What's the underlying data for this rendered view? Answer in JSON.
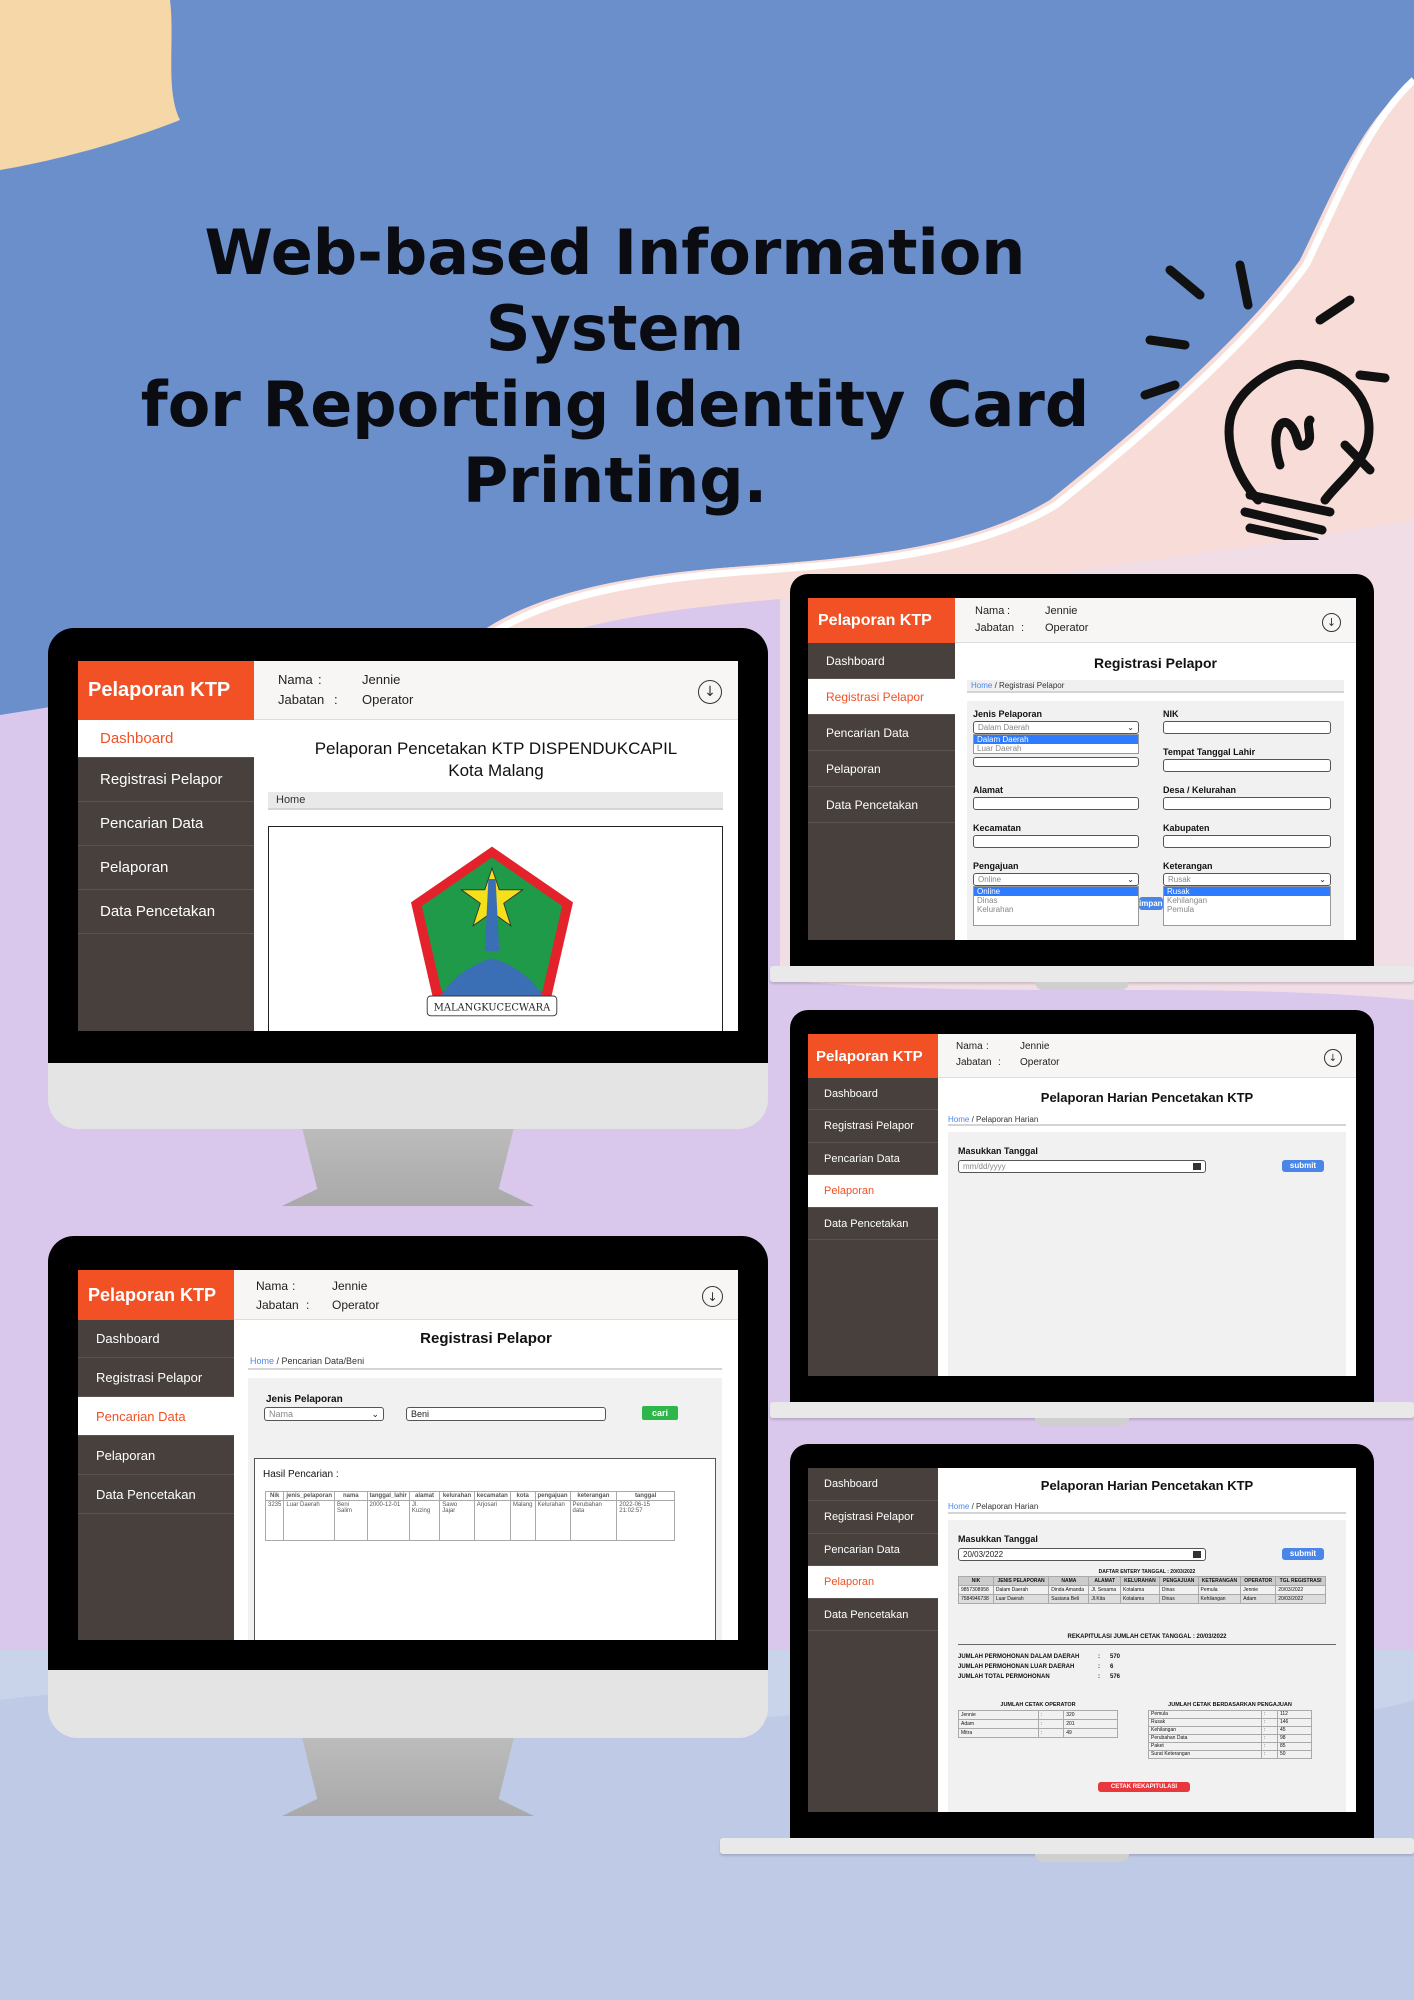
{
  "headline": [
    "Web-based Information System",
    "for Reporting Identity Card",
    "Printing."
  ],
  "brand": "Pelaporan KTP",
  "user": {
    "nama_label": "Nama",
    "jabatan_label": "Jabatan",
    "sep": ":",
    "nama": "Jennie",
    "jabatan": "Operator"
  },
  "download_glyph": "↓",
  "nav": [
    "Dashboard",
    "Registrasi Pelapor",
    "Pencarian Data",
    "Pelaporan",
    "Data Pencetakan"
  ],
  "dashboard": {
    "title_line1": "Pelaporan Pencetakan KTP DISPENDUKCAPIL",
    "title_line2": "Kota Malang",
    "crumb": "Home",
    "logo_text": "MALANGKUCECWARA"
  },
  "registrasi": {
    "title": "Registrasi Pelapor",
    "crumb_home": "Home",
    "crumb_rest": " / Registrasi Pelapor",
    "jenis_label": "Jenis Pelaporan",
    "jenis_value": "Dalam Daerah",
    "jenis_options": [
      "Dalam Daerah",
      "Luar Daerah"
    ],
    "nik_label": "NIK",
    "ttl_label": "Tempat Tanggal Lahir",
    "alamat_label": "Alamat",
    "desa_label": "Desa / Kelurahan",
    "kecamatan_label": "Kecamatan",
    "kabupaten_label": "Kabupaten",
    "pengajuan_label": "Pengajuan",
    "pengajuan_value": "Online",
    "pengajuan_options": [
      "Online",
      "Dinas",
      "Kelurahan"
    ],
    "keterangan_label": "Keterangan",
    "keterangan_value": "Rusak",
    "keterangan_options": [
      "Rusak",
      "Kehilangan",
      "Pemula"
    ],
    "simpan_fragment": "impan"
  },
  "pencarian": {
    "title": "Registrasi Pelapor",
    "crumb_home": "Home",
    "crumb_rest": " / Pencarian Data/Beni",
    "jenis_label": "Jenis Pelaporan",
    "select_placeholder": "Nama",
    "query": "Beni",
    "button": "cari",
    "result_label": "Hasil Pencarian :",
    "columns": [
      "Nik",
      "jenis_pelaporan",
      "nama",
      "tanggal_lahir",
      "alamat",
      "kelurahan",
      "kecamatan",
      "kota",
      "pengajuan",
      "keterangan",
      "tanggal"
    ],
    "rows": [
      [
        "3235",
        "Luar Daerah",
        "Beni Salim",
        "2000-12-01",
        "Jl. Kuzing",
        "Sawo Jajar",
        "Arjosari",
        "Malang",
        "Kelurahan",
        "Perubahan data",
        "2022-06-15 21:02:57"
      ]
    ]
  },
  "harian": {
    "title": "Pelaporan Harian Pencetakan KTP",
    "crumb_home": "Home",
    "crumb_rest": " / Pelaporan Harian",
    "date_label": "Masukkan Tanggal",
    "date_placeholder": "mm/dd/yyyy",
    "button": "submit"
  },
  "rekap": {
    "date_value": "20/03/2022",
    "entry_title": "DAFTAR ENTERY TANGGAL : 20/03/2022",
    "entry_columns": [
      "NIK",
      "JENIS PELAPORAN",
      "NAMA",
      "ALAMAT",
      "KELURAHAN",
      "PENGAJUAN",
      "KETERANGAN",
      "OPERATOR",
      "TGL REGISTRASI"
    ],
    "entry_rows": [
      [
        "9857308958",
        "Dalam Daerah",
        "Dinda Amanda",
        "Jl. Sesama",
        "Kotalama",
        "Dinas",
        "Pemula",
        "Jennie",
        "20/03/2022"
      ],
      [
        "7584946738",
        "Luar Daerah",
        "Susiana Beli",
        "Jl.Kita",
        "Kotalama",
        "Dinas",
        "Kehilangan",
        "Adam",
        "20/03/2022"
      ]
    ],
    "summary_title": "REKAPITULASI JUMLAH CETAK TANGGAL : 20/03/2022",
    "summary": [
      {
        "label": "JUMLAH PERMOHONAN DALAM DAERAH",
        "value": "570"
      },
      {
        "label": "JUMLAH PERMOHONAN LUAR DAERAH",
        "value": "6"
      },
      {
        "label": "JUMLAH TOTAL PERMOHONAN",
        "value": "576"
      }
    ],
    "operator_title": "JUMLAH CETAK OPERATOR",
    "operators": [
      [
        "Jennie",
        "320"
      ],
      [
        "Adam",
        "201"
      ],
      [
        "Mitra",
        "49"
      ]
    ],
    "pengajuan_title": "JUMLAH CETAK BERDASARKAN PENGAJUAN",
    "pengajuan": [
      [
        "Pemula",
        "112"
      ],
      [
        "Rusak",
        "146"
      ],
      [
        "Kehilangan",
        "45"
      ],
      [
        "Perubahan Data",
        "98"
      ],
      [
        "Paket",
        "85"
      ],
      [
        "Surat Keterangan",
        "50"
      ]
    ],
    "print_button": "CETAK REKAPITULASI"
  },
  "colors": {
    "brand": "#f15125",
    "sidebar": "#47403d",
    "link": "#4a86e8",
    "paper_blue": "#6a8fcb",
    "paper_pink": "#f8dcd7",
    "paper_lilac": "#d9c8ec"
  }
}
